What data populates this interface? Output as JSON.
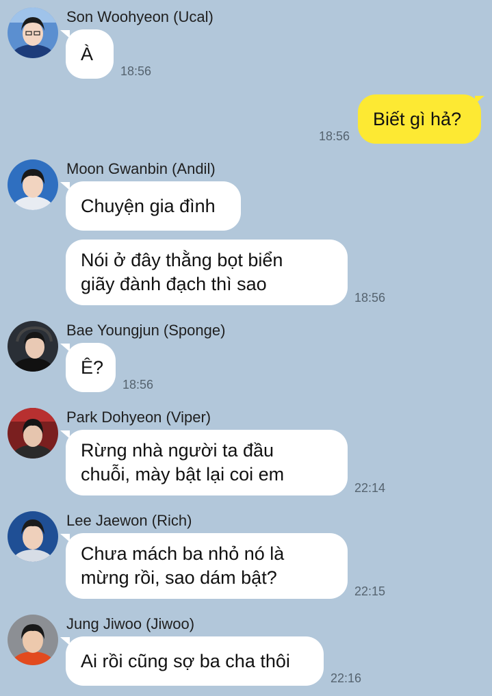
{
  "messages": [
    {
      "sender": "Son Woohyeon (Ucal)",
      "text_lines": [
        "À"
      ],
      "time": "18:56"
    },
    {
      "sender": "",
      "text_lines": [
        "Biết gì hả?"
      ],
      "time": "18:56"
    },
    {
      "sender": "Moon Gwanbin (Andil)",
      "text_lines": [
        "Chuyện gia đình"
      ],
      "time": ""
    },
    {
      "sender": "",
      "text_lines": [
        "Nói ở đây thằng bọt biển",
        "giãy đành đạch thì sao"
      ],
      "time": "18:56"
    },
    {
      "sender": "Bae Youngjun (Sponge)",
      "text_lines": [
        "Ê?"
      ],
      "time": "18:56"
    },
    {
      "sender": "Park Dohyeon (Viper)",
      "text_lines": [
        "Rừng nhà người ta đầu",
        "chuỗi, mày bật lại coi em"
      ],
      "time": "22:14"
    },
    {
      "sender": "Lee Jaewon (Rich)",
      "text_lines": [
        "Chưa mách ba nhỏ nó là",
        "mừng rồi, sao dám bật?"
      ],
      "time": "22:15"
    },
    {
      "sender": "Jung Jiwoo (Jiwoo)",
      "text_lines": [
        "Ai rồi cũng sợ ba cha thôi"
      ],
      "time": "22:16"
    }
  ],
  "colors": {
    "background": "#b2c7da",
    "own_bubble": "#fde933",
    "other_bubble": "#ffffff"
  },
  "icons": [
    "avatar-ucal",
    "avatar-andil",
    "avatar-sponge",
    "avatar-viper",
    "avatar-rich",
    "avatar-jiwoo"
  ]
}
